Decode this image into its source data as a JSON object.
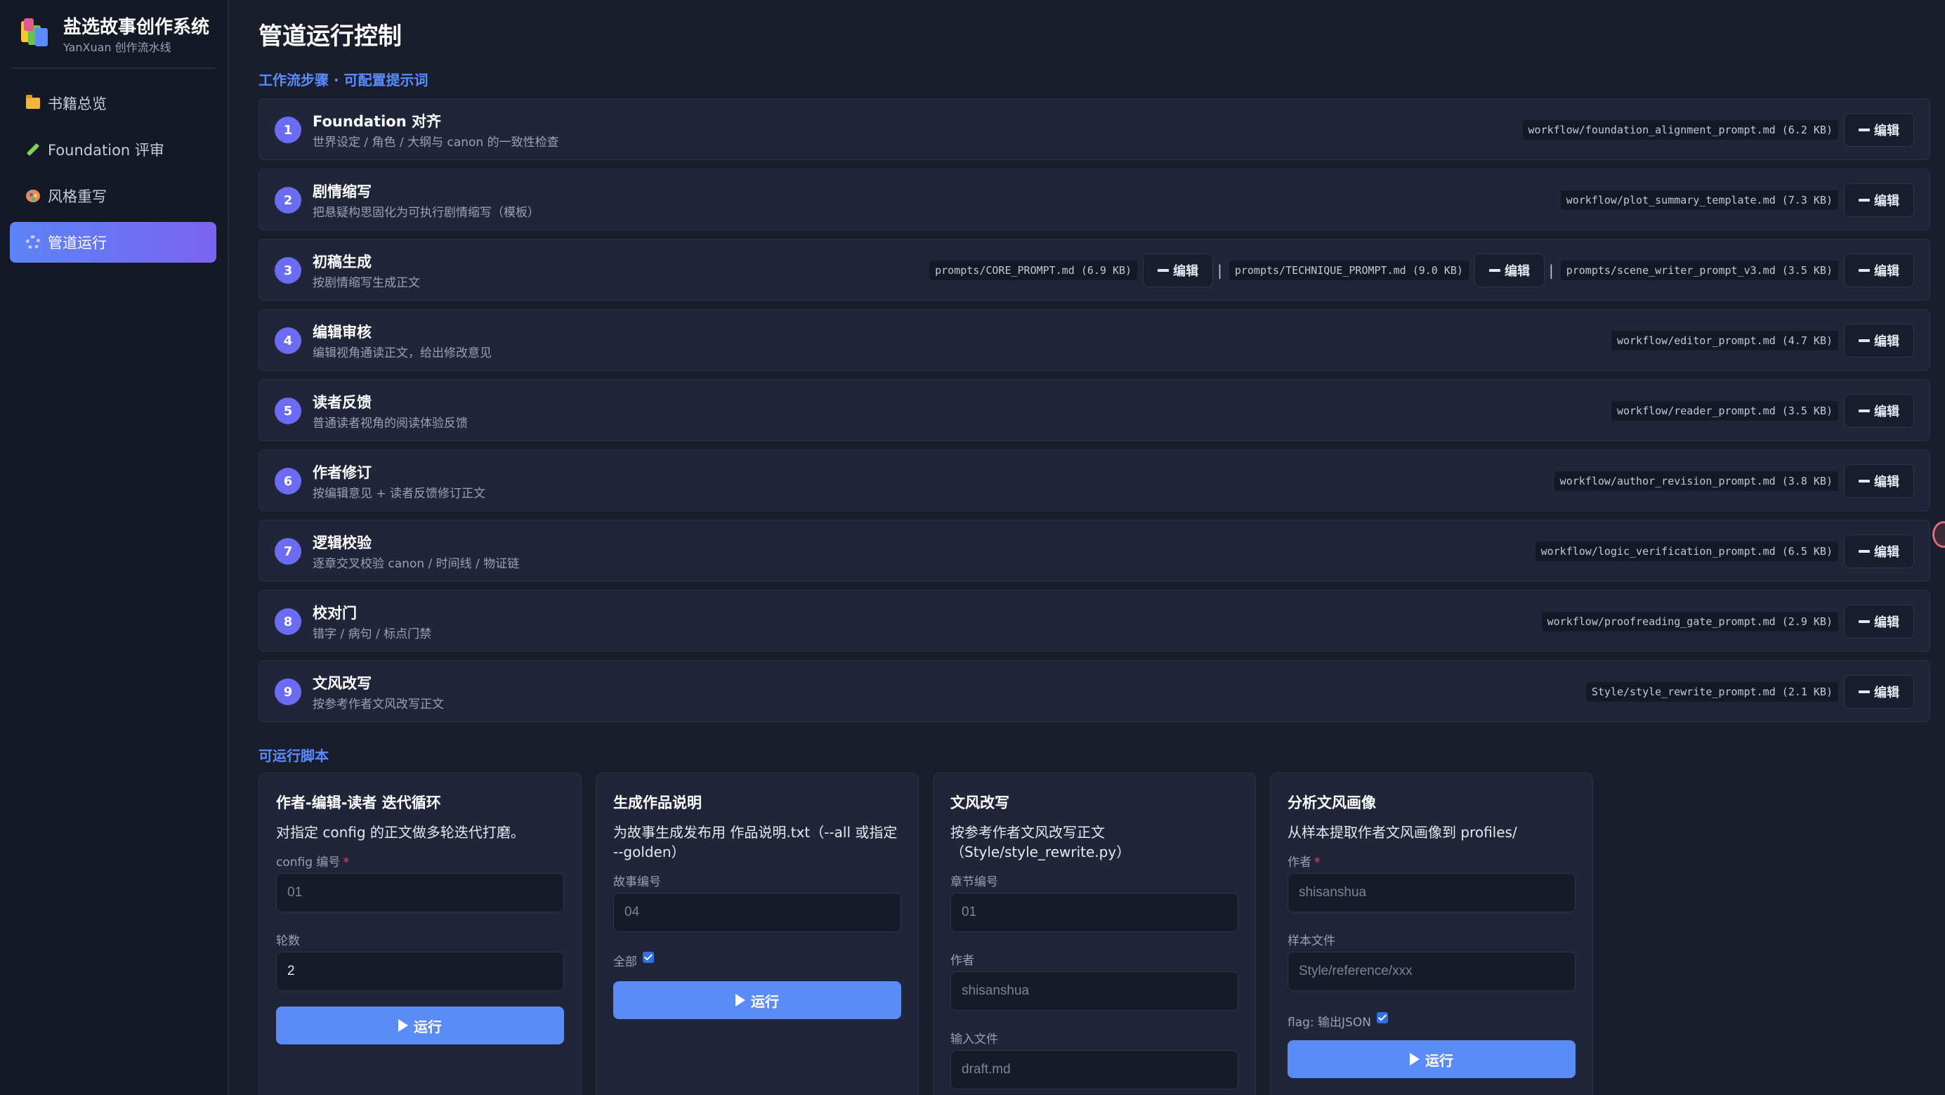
{
  "sidebar": {
    "brand_title": "盐选故事创作系统",
    "brand_subtitle": "YanXuan 创作流水线",
    "items": [
      {
        "label": "书籍总览",
        "icon": "folder-icon"
      },
      {
        "label": "Foundation 评审",
        "icon": "pencil-icon"
      },
      {
        "label": "风格重写",
        "icon": "palette-icon"
      },
      {
        "label": "管道运行",
        "icon": "gear-icon",
        "active": true
      }
    ]
  },
  "main": {
    "title": "管道运行控制",
    "workflow_section": "工作流步骤 · 可配置提示词",
    "scripts_section": "可运行脚本"
  },
  "edit_label": "编辑",
  "steps": [
    {
      "num": "1",
      "name": "Foundation 对齐",
      "desc": "世界设定 / 角色 / 大纲与 canon 的一致性检查",
      "files": [
        "workflow/foundation_alignment_prompt.md (6.2 KB)"
      ]
    },
    {
      "num": "2",
      "name": "剧情缩写",
      "desc": "把悬疑构思固化为可执行剧情缩写（模板）",
      "files": [
        "workflow/plot_summary_template.md (7.3 KB)"
      ]
    },
    {
      "num": "3",
      "name": "初稿生成",
      "desc": "按剧情缩写生成正文",
      "files": [
        "prompts/CORE_PROMPT.md (6.9 KB)",
        "prompts/TECHNIQUE_PROMPT.md (9.0 KB)",
        "prompts/scene_writer_prompt_v3.md (3.5 KB)"
      ]
    },
    {
      "num": "4",
      "name": "编辑审核",
      "desc": "编辑视角通读正文，给出修改意见",
      "files": [
        "workflow/editor_prompt.md (4.7 KB)"
      ]
    },
    {
      "num": "5",
      "name": "读者反馈",
      "desc": "普通读者视角的阅读体验反馈",
      "files": [
        "workflow/reader_prompt.md (3.5 KB)"
      ]
    },
    {
      "num": "6",
      "name": "作者修订",
      "desc": "按编辑意见 + 读者反馈修订正文",
      "files": [
        "workflow/author_revision_prompt.md (3.8 KB)"
      ]
    },
    {
      "num": "7",
      "name": "逻辑校验",
      "desc": "逐章交叉校验 canon / 时间线 / 物证链",
      "files": [
        "workflow/logic_verification_prompt.md (6.5 KB)"
      ]
    },
    {
      "num": "8",
      "name": "校对门",
      "desc": "错字 / 病句 / 标点门禁",
      "files": [
        "workflow/proofreading_gate_prompt.md (2.9 KB)"
      ]
    },
    {
      "num": "9",
      "name": "文风改写",
      "desc": "按参考作者文风改写正文",
      "files": [
        "Style/style_rewrite_prompt.md (2.1 KB)"
      ]
    }
  ],
  "run_label": "运行",
  "cards": {
    "iterate": {
      "title": "作者-编辑-读者 迭代循环",
      "desc": "对指定 config 的正文做多轮迭代打磨。",
      "config_label": "config 编号",
      "config_placeholder": "01",
      "rounds_label": "轮数",
      "rounds_value": "2"
    },
    "summary": {
      "title": "生成作品说明",
      "desc": "为故事生成发布用 作品说明.txt（--all 或指定 --golden）",
      "story_label": "故事编号",
      "story_placeholder": "04",
      "all_label": "全部"
    },
    "rewrite": {
      "title": "文风改写",
      "desc": "按参考作者文风改写正文（Style/style_rewrite.py）",
      "chapter_label": "章节编号",
      "chapter_placeholder": "01",
      "author_label": "作者",
      "author_placeholder": "shisanshua",
      "input_label": "输入文件",
      "input_placeholder": "draft.md"
    },
    "profile": {
      "title": "分析文风画像",
      "desc": "从样本提取作者文风画像到 profiles/",
      "author_label": "作者",
      "author_placeholder": "shisanshua",
      "sample_label": "样本文件",
      "sample_placeholder": "Style/reference/xxx",
      "flag_label": "flag: 输出JSON"
    }
  },
  "colors": {
    "accent": "#5b8cf5",
    "step_badge": "#6c6cf2",
    "required": "#f04a5a"
  }
}
